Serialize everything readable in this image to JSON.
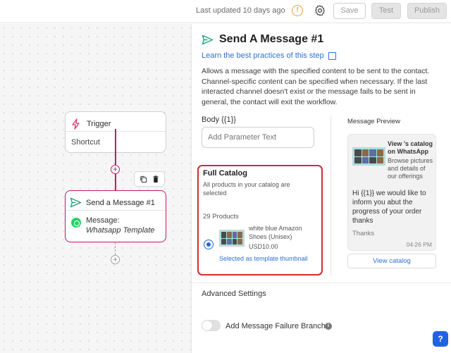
{
  "topbar": {
    "last_updated": "Last updated 10 days ago",
    "warning_glyph": "!",
    "save_label": "Save",
    "test_label": "Test",
    "publish_label": "Publish"
  },
  "canvas": {
    "trigger": {
      "title": "Trigger",
      "value": "Shortcut"
    },
    "add_glyph": "+",
    "message_node": {
      "title": "Send a Message #1",
      "label": "Message:",
      "template": "Whatsapp Template"
    }
  },
  "panel": {
    "title": "Send A Message #1",
    "best_practices_link": "Learn the best practices of this step",
    "description": "Allows a message with the specified content to be sent to the contact. Channel-specific content can be specified when necessary. If the last interacted channel doesn't exist or the message fails to be sent in general, the contact will exit the workflow.",
    "body_label": "Body {{1}}",
    "body_placeholder": "Add Parameter Text",
    "catalog": {
      "title": "Full Catalog",
      "subtitle": "All products in your catalog are selected",
      "count": "29 Products",
      "product_name": "white blue Amazon Shoes (Unisex)",
      "price": "USD10.00",
      "selected_note": "Selected as template thumbnail"
    },
    "preview": {
      "label": "Message Preview",
      "card_title": "View 's catalog on WhatsApp",
      "card_desc": "Browse pictures and details of our offerings",
      "message": "Hi {{1}} we would like to inform you abut the progress of your order thanks",
      "signoff": "Thanks",
      "time": "04:26 PM",
      "view_catalog": "View catalog"
    },
    "advanced_label": "Advanced Settings",
    "failure_branch_label": "Add Message Failure Branch",
    "info_glyph": "i",
    "help_glyph": "?"
  },
  "colors": {
    "accent_pink": "#c8175f",
    "highlight_red": "#d62c2c",
    "link_blue": "#2f6fd6",
    "warning": "#e8a23c",
    "whatsapp": "#25d366",
    "send_icon_teal": "#1aa37a"
  },
  "icons": [
    "warning-icon",
    "gear-icon",
    "lightning-icon",
    "send-icon",
    "whatsapp-icon",
    "copy-icon",
    "trash-icon",
    "external-link-icon",
    "info-icon",
    "help-icon"
  ]
}
